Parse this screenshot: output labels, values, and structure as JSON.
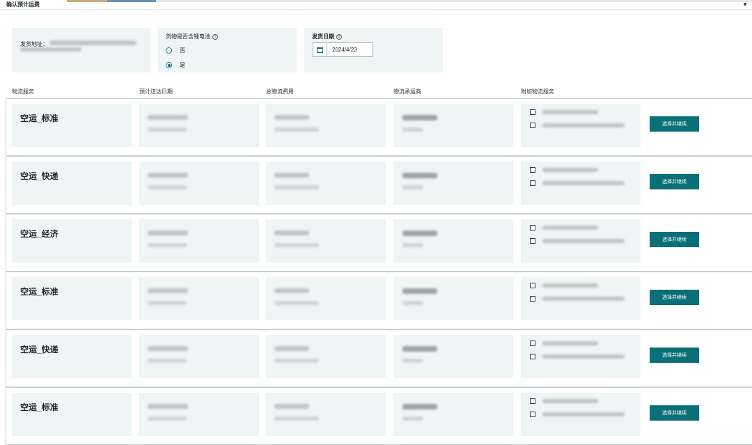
{
  "header": {
    "title": "确认预计运费",
    "collapse_icon": "caret-down-icon"
  },
  "shipping_address": {
    "label": "发货地址："
  },
  "battery_question": {
    "label": "货物是否含锂电池",
    "options": [
      "否",
      "是"
    ],
    "selected": "是"
  },
  "ship_date": {
    "label": "发货日期",
    "value": "2024/4/23"
  },
  "columns": [
    "物流服务",
    "预计送达日期",
    "总物流费用",
    "物流承运商",
    "附加物流服务"
  ],
  "options": [
    {
      "service": "空运_标准",
      "button": "选择并继续"
    },
    {
      "service": "空运_快递",
      "button": "选择并继续"
    },
    {
      "service": "空运_经济",
      "button": "选择并继续"
    },
    {
      "service": "空运_标准",
      "button": "选择并继续"
    },
    {
      "service": "空运_快递",
      "button": "选择并继续"
    },
    {
      "service": "空运_标准",
      "button": "选择并继续"
    }
  ],
  "colors": {
    "accent": "#0b6f78",
    "panel": "#eef5f4",
    "border": "#c9d1d1"
  }
}
